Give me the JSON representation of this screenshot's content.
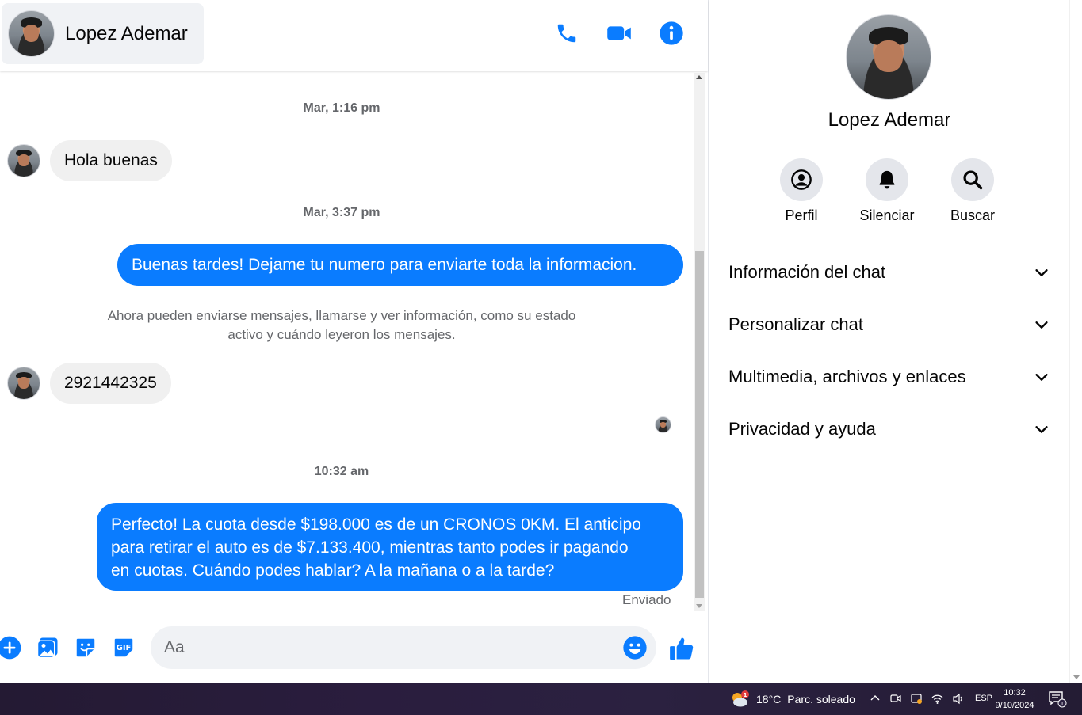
{
  "contact": {
    "name": "Lopez Ademar"
  },
  "header": {
    "icons": [
      "phone-icon",
      "video-camera-icon",
      "info-icon"
    ]
  },
  "messages": {
    "ts1": "Mar, 1:16 pm",
    "msg1": "Hola buenas",
    "ts2": "Mar, 3:37 pm",
    "msg2": "Buenas tardes! Dejame tu numero para enviarte toda la informacion.",
    "system_line1": "Ahora pueden enviarse mensajes, llamarse y ver información, como su estado",
    "system_line2": "activo y cuándo leyeron los mensajes.",
    "msg3": "2921442325",
    "ts3": "10:32 am",
    "msg4_line1": "Perfecto! La cuota desde $198.000 es de un CRONOS 0KM. El anticipo",
    "msg4_line2": "para retirar el auto es de $7.133.400, mientras tanto podes ir pagando",
    "msg4_line3": "en cuotas. Cuándo podes hablar? A la mañana o a la tarde?",
    "status": "Enviado"
  },
  "composer": {
    "placeholder": "Aa"
  },
  "info": {
    "actions": {
      "profile": "Perfil",
      "mute": "Silenciar",
      "search": "Buscar"
    },
    "sections": {
      "chat_info": "Información del chat",
      "customize": "Personalizar chat",
      "media": "Multimedia, archivos y enlaces",
      "privacy": "Privacidad y ayuda"
    }
  },
  "taskbar": {
    "weather_temp": "18°C",
    "weather_desc": "Parc. soleado",
    "weather_badge": "1",
    "language": "ESP",
    "time": "10:32",
    "date": "9/10/2024",
    "notification_count": "1"
  },
  "colors": {
    "accent": "#0a7cff",
    "incoming_bubble": "#f0f0f0",
    "secondary_text": "#65676b"
  }
}
